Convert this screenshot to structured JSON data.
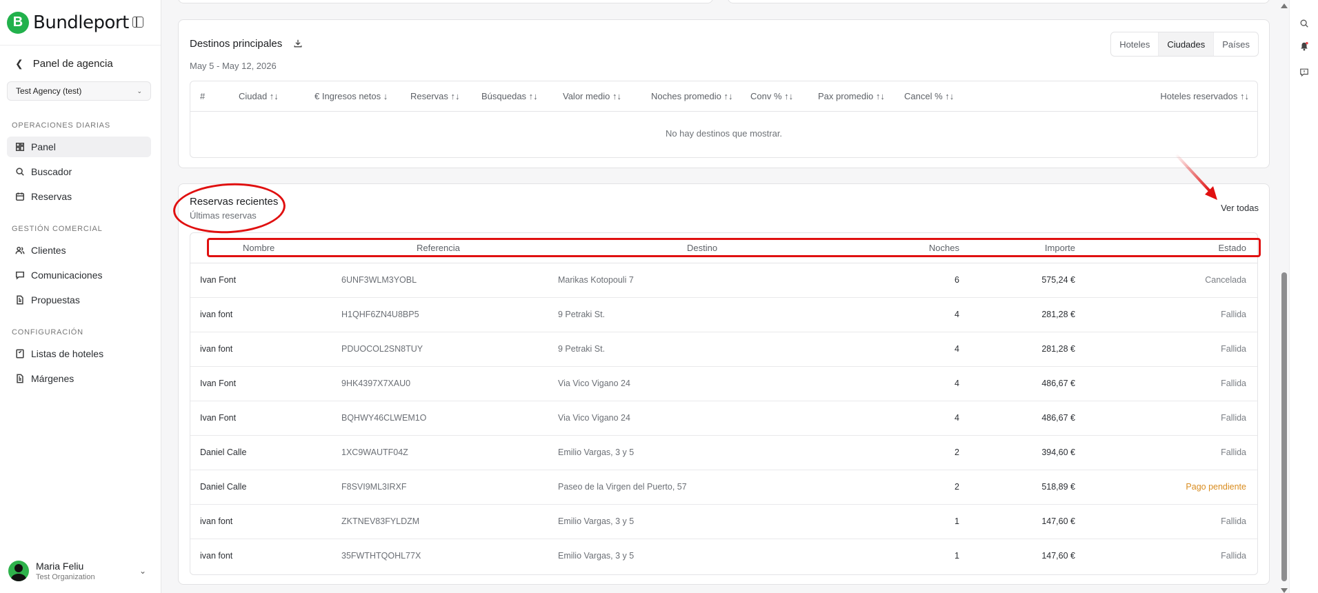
{
  "brand": {
    "name": "Bundleport",
    "logo_letter": "B",
    "accent": "#22b14c"
  },
  "sidebar": {
    "back_label": "Panel de agencia",
    "agency_select": "Test Agency (test)",
    "sections": [
      {
        "label": "OPERACIONES DIARIAS",
        "items": [
          {
            "label": "Panel",
            "icon": "dashboard-icon",
            "active": true
          },
          {
            "label": "Buscador",
            "icon": "search-icon"
          },
          {
            "label": "Reservas",
            "icon": "calendar-icon"
          }
        ]
      },
      {
        "label": "GESTIÓN COMERCIAL",
        "items": [
          {
            "label": "Clientes",
            "icon": "users-icon"
          },
          {
            "label": "Comunicaciones",
            "icon": "chat-icon"
          },
          {
            "label": "Propuestas",
            "icon": "document-icon"
          }
        ]
      },
      {
        "label": "CONFIGURACIÓN",
        "items": [
          {
            "label": "Listas de hoteles",
            "icon": "bookmark-list-icon"
          },
          {
            "label": "Márgenes",
            "icon": "document-icon"
          }
        ]
      }
    ],
    "user": {
      "name": "Maria Feliu",
      "org": "Test Organization"
    }
  },
  "destinations": {
    "title": "Destinos principales",
    "date_range": "May 5 - May 12, 2026",
    "segments": [
      "Hoteles",
      "Ciudades",
      "Países"
    ],
    "active_segment": "Ciudades",
    "columns": [
      "#",
      "Ciudad ↑↓",
      "€ Ingresos netos ↓",
      "Reservas ↑↓",
      "Búsquedas ↑↓",
      "Valor medio ↑↓",
      "Noches promedio ↑↓",
      "Conv % ↑↓",
      "Pax promedio ↑↓",
      "Cancel % ↑↓",
      "Hoteles reservados ↑↓"
    ],
    "empty_message": "No hay destinos que mostrar."
  },
  "recent": {
    "title": "Reservas recientes",
    "subtitle": "Últimas reservas",
    "view_all": "Ver todas",
    "columns": [
      "Nombre",
      "Referencia",
      "Destino",
      "Noches",
      "Importe",
      "Estado"
    ],
    "rows": [
      {
        "name": "Ivan Font",
        "ref": "6UNF3WLM3YOBL",
        "dest": "Marikas Kotopouli 7",
        "nights": "6",
        "amount": "575,24 €",
        "status": "Cancelada"
      },
      {
        "name": "ivan font",
        "ref": "H1QHF6ZN4U8BP5",
        "dest": "9 Petraki St.",
        "nights": "4",
        "amount": "281,28 €",
        "status": "Fallida"
      },
      {
        "name": "ivan font",
        "ref": "PDUOCOL2SN8TUY",
        "dest": "9 Petraki St.",
        "nights": "4",
        "amount": "281,28 €",
        "status": "Fallida"
      },
      {
        "name": "Ivan Font",
        "ref": "9HK4397X7XAU0",
        "dest": "Via Vico Vigano 24",
        "nights": "4",
        "amount": "486,67 €",
        "status": "Fallida"
      },
      {
        "name": "Ivan Font",
        "ref": "BQHWY46CLWEM1O",
        "dest": "Via Vico Vigano 24",
        "nights": "4",
        "amount": "486,67 €",
        "status": "Fallida"
      },
      {
        "name": "Daniel Calle",
        "ref": "1XC9WAUTF04Z",
        "dest": "Emilio Vargas, 3 y 5",
        "nights": "2",
        "amount": "394,60 €",
        "status": "Fallida"
      },
      {
        "name": "Daniel Calle",
        "ref": "F8SVI9ML3IRXF",
        "dest": "Paseo de la Virgen del Puerto, 57",
        "nights": "2",
        "amount": "518,89 €",
        "status": "Pago pendiente"
      },
      {
        "name": "ivan font",
        "ref": "ZKTNEV83FYLDZM",
        "dest": "Emilio Vargas, 3 y 5",
        "nights": "1",
        "amount": "147,60 €",
        "status": "Fallida"
      },
      {
        "name": "ivan font",
        "ref": "35FWTHTQOHL77X",
        "dest": "Emilio Vargas, 3 y 5",
        "nights": "1",
        "amount": "147,60 €",
        "status": "Fallida"
      }
    ]
  },
  "colors": {
    "annotation": "#e01010",
    "pending": "#d98c1f"
  },
  "rail_icons": [
    "search-icon",
    "bell-icon",
    "feedback-icon"
  ]
}
